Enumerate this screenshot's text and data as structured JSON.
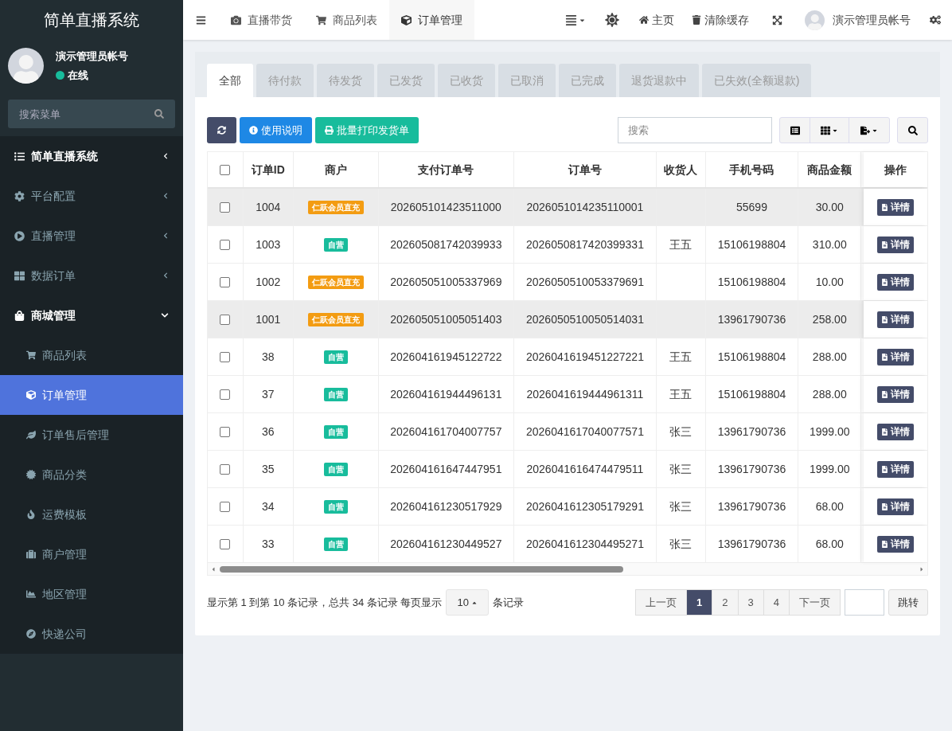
{
  "sidebar": {
    "title": "简单直播系统",
    "user": {
      "name": "演示管理员帐号",
      "status": "在线",
      "online": true
    },
    "search": {
      "placeholder": "搜索菜单"
    },
    "items": [
      {
        "label": "简单直播系统",
        "kind": "header",
        "expanded": false,
        "selected": false
      },
      {
        "label": "平台配置",
        "kind": "group",
        "expanded": false,
        "selected": false
      },
      {
        "label": "直播管理",
        "kind": "group",
        "expanded": false,
        "selected": false
      },
      {
        "label": "数据订单",
        "kind": "group",
        "expanded": false,
        "selected": false
      },
      {
        "label": "商城管理",
        "kind": "group",
        "expanded": true,
        "selected": false,
        "children": [
          {
            "label": "商品列表",
            "selected": false
          },
          {
            "label": "订单管理",
            "selected": true
          },
          {
            "label": "订单售后管理",
            "selected": false
          },
          {
            "label": "商品分类",
            "selected": false
          },
          {
            "label": "运费模板",
            "selected": false
          },
          {
            "label": "商户管理",
            "selected": false
          },
          {
            "label": "地区管理",
            "selected": false
          },
          {
            "label": "快递公司",
            "selected": false
          }
        ]
      }
    ]
  },
  "topbar": {
    "tabs": [
      {
        "label": "直播带货",
        "selected": false
      },
      {
        "label": "商品列表",
        "selected": false
      },
      {
        "label": "订单管理",
        "selected": true
      }
    ],
    "light_mode": true,
    "links": [
      {
        "label": "主页"
      },
      {
        "label": "清除缓存"
      }
    ],
    "user": "演示管理员帐号"
  },
  "status_tabs": [
    {
      "label": "全部",
      "selected": true
    },
    {
      "label": "待付款",
      "selected": false
    },
    {
      "label": "待发货",
      "selected": false
    },
    {
      "label": "已发货",
      "selected": false
    },
    {
      "label": "已收货",
      "selected": false
    },
    {
      "label": "已取消",
      "selected": false
    },
    {
      "label": "已完成",
      "selected": false
    },
    {
      "label": "退货退款中",
      "selected": false
    },
    {
      "label": "已失效(全额退款)",
      "selected": false
    }
  ],
  "toolbar": {
    "buttons": [
      "使用说明",
      "批量打印发货单"
    ],
    "search_placeholder": "搜索"
  },
  "table": {
    "columns": [
      "订单ID",
      "商户",
      "支付订单号",
      "订单号",
      "收货人",
      "手机号码",
      "商品金额",
      "操作"
    ],
    "header_checked": false,
    "rows": [
      {
        "checked": false,
        "highlighted": true,
        "id": "1004",
        "merchant": "仁跃会员直充",
        "color": "#f39c12",
        "pay_no": "202605101423511000",
        "order_no": "2026051014235110001",
        "receiver": "",
        "phone": "55699",
        "amount": "30.00",
        "action": "详情"
      },
      {
        "checked": false,
        "highlighted": false,
        "id": "1003",
        "merchant": "自营",
        "color": "#18bc9c",
        "pay_no": "202605081742039933",
        "order_no": "2026050817420399331",
        "receiver": "王五",
        "phone": "15106198804",
        "amount": "310.00",
        "action": "详情"
      },
      {
        "checked": false,
        "highlighted": false,
        "id": "1002",
        "merchant": "仁跃会员直充",
        "color": "#f39c12",
        "pay_no": "202605051005337969",
        "order_no": "2026050510053379691",
        "receiver": "",
        "phone": "15106198804",
        "amount": "10.00",
        "action": "详情"
      },
      {
        "checked": false,
        "highlighted": true,
        "id": "1001",
        "merchant": "仁跃会员直充",
        "color": "#f39c12",
        "pay_no": "202605051005051403",
        "order_no": "2026050510050514031",
        "receiver": "",
        "phone": "13961790736",
        "amount": "258.00",
        "action": "详情"
      },
      {
        "checked": false,
        "highlighted": false,
        "id": "38",
        "merchant": "自营",
        "color": "#18bc9c",
        "pay_no": "202604161945122722",
        "order_no": "2026041619451227221",
        "receiver": "王五",
        "phone": "15106198804",
        "amount": "288.00",
        "action": "详情"
      },
      {
        "checked": false,
        "highlighted": false,
        "id": "37",
        "merchant": "自营",
        "color": "#18bc9c",
        "pay_no": "202604161944496131",
        "order_no": "2026041619444961311",
        "receiver": "王五",
        "phone": "15106198804",
        "amount": "288.00",
        "action": "详情"
      },
      {
        "checked": false,
        "highlighted": false,
        "id": "36",
        "merchant": "自营",
        "color": "#18bc9c",
        "pay_no": "202604161704007757",
        "order_no": "2026041617040077571",
        "receiver": "张三",
        "phone": "13961790736",
        "amount": "1999.00",
        "action": "详情"
      },
      {
        "checked": false,
        "highlighted": false,
        "id": "35",
        "merchant": "自营",
        "color": "#18bc9c",
        "pay_no": "202604161647447951",
        "order_no": "2026041616474479511",
        "receiver": "张三",
        "phone": "13961790736",
        "amount": "1999.00",
        "action": "详情"
      },
      {
        "checked": false,
        "highlighted": false,
        "id": "34",
        "merchant": "自营",
        "color": "#18bc9c",
        "pay_no": "202604161230517929",
        "order_no": "2026041612305179291",
        "receiver": "张三",
        "phone": "13961790736",
        "amount": "68.00",
        "action": "详情"
      },
      {
        "checked": false,
        "highlighted": false,
        "id": "33",
        "merchant": "自营",
        "color": "#18bc9c",
        "pay_no": "202604161230449527",
        "order_no": "2026041612304495271",
        "receiver": "张三",
        "phone": "13961790736",
        "amount": "68.00",
        "action": "详情"
      }
    ]
  },
  "footer": {
    "summary": "显示第 1 到第 10 条记录，总共 34 条记录 每页显示",
    "page_size": "10",
    "summary_end": "条记录",
    "pages": [
      {
        "label": "上一页",
        "selected": false
      },
      {
        "label": "1",
        "selected": true
      },
      {
        "label": "2",
        "selected": false
      },
      {
        "label": "3",
        "selected": false
      },
      {
        "label": "4",
        "selected": false
      },
      {
        "label": "下一页",
        "selected": false
      }
    ],
    "jump": "跳转"
  }
}
